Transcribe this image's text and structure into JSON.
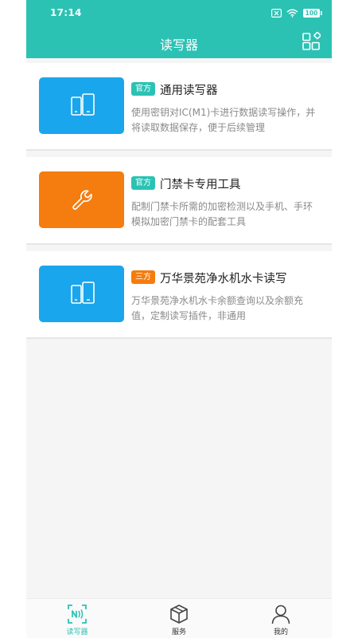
{
  "status_bar": {
    "time": "17:14",
    "battery": "100"
  },
  "header": {
    "title": "读写器"
  },
  "cards": [
    {
      "tag": "官方",
      "title": "通用读写器",
      "desc": "使用密钥对IC(M1)卡进行数据读写操作，并将读取数据保存，便于后续管理",
      "icon": "phone-card-icon",
      "color": "#1aa6ec"
    },
    {
      "tag": "官方",
      "title": "门禁卡专用工具",
      "desc": "配制门禁卡所需的加密检测以及手机、手环模拟加密门禁卡的配套工具",
      "icon": "wrench-icon",
      "color": "#f57c0e"
    },
    {
      "tag": "三方",
      "title": "万华景苑净水机水卡读写",
      "desc": "万华景苑净水机水卡余额查询以及余额充值，定制读写插件，非通用",
      "icon": "phone-card-icon",
      "color": "#1aa6ec"
    }
  ],
  "tabbar": [
    {
      "label": "读写器",
      "icon": "nfc-icon",
      "active": true
    },
    {
      "label": "服务",
      "icon": "cube-icon",
      "active": false
    },
    {
      "label": "我的",
      "icon": "person-icon",
      "active": false
    }
  ],
  "colors": {
    "primary": "#2bc2b4",
    "blue": "#1aa6ec",
    "orange": "#f57c0e"
  }
}
